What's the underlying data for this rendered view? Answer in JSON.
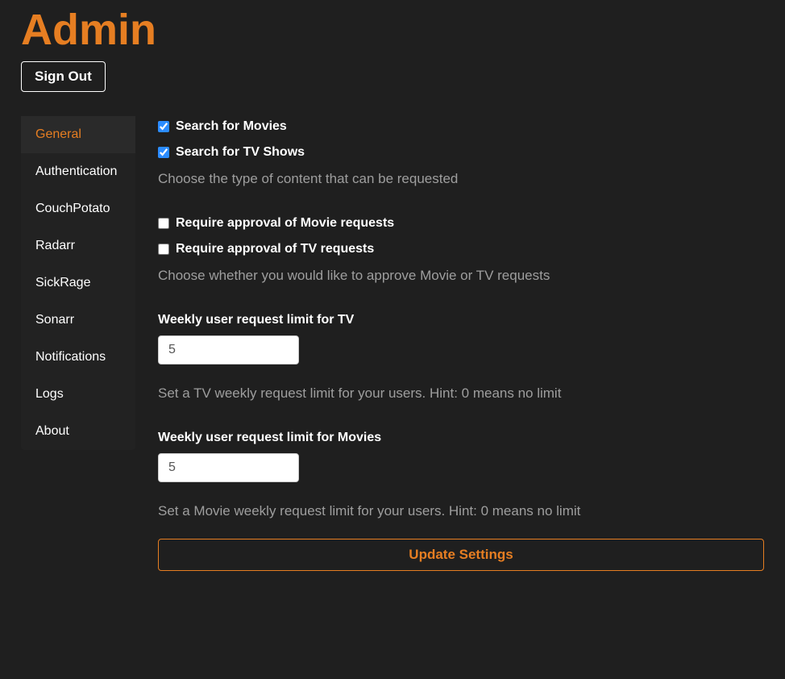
{
  "header": {
    "title": "Admin",
    "signout_label": "Sign Out"
  },
  "sidebar": {
    "items": [
      {
        "label": "General",
        "active": true
      },
      {
        "label": "Authentication",
        "active": false
      },
      {
        "label": "CouchPotato",
        "active": false
      },
      {
        "label": "Radarr",
        "active": false
      },
      {
        "label": "SickRage",
        "active": false
      },
      {
        "label": "Sonarr",
        "active": false
      },
      {
        "label": "Notifications",
        "active": false
      },
      {
        "label": "Logs",
        "active": false
      },
      {
        "label": "About",
        "active": false
      }
    ]
  },
  "form": {
    "search_movies": {
      "label": "Search for Movies",
      "checked": true
    },
    "search_tv": {
      "label": "Search for TV Shows",
      "checked": true
    },
    "content_help": "Choose the type of content that can be requested",
    "approve_movies": {
      "label": "Require approval of Movie requests",
      "checked": false
    },
    "approve_tv": {
      "label": "Require approval of TV requests",
      "checked": false
    },
    "approve_help": "Choose whether you would like to approve Movie or TV requests",
    "tv_limit": {
      "label": "Weekly user request limit for TV",
      "value": "5",
      "help": "Set a TV weekly request limit for your users. Hint: 0 means no limit"
    },
    "movie_limit": {
      "label": "Weekly user request limit for Movies",
      "value": "5",
      "help": "Set a Movie weekly request limit for your users. Hint: 0 means no limit"
    },
    "update_label": "Update Settings"
  }
}
